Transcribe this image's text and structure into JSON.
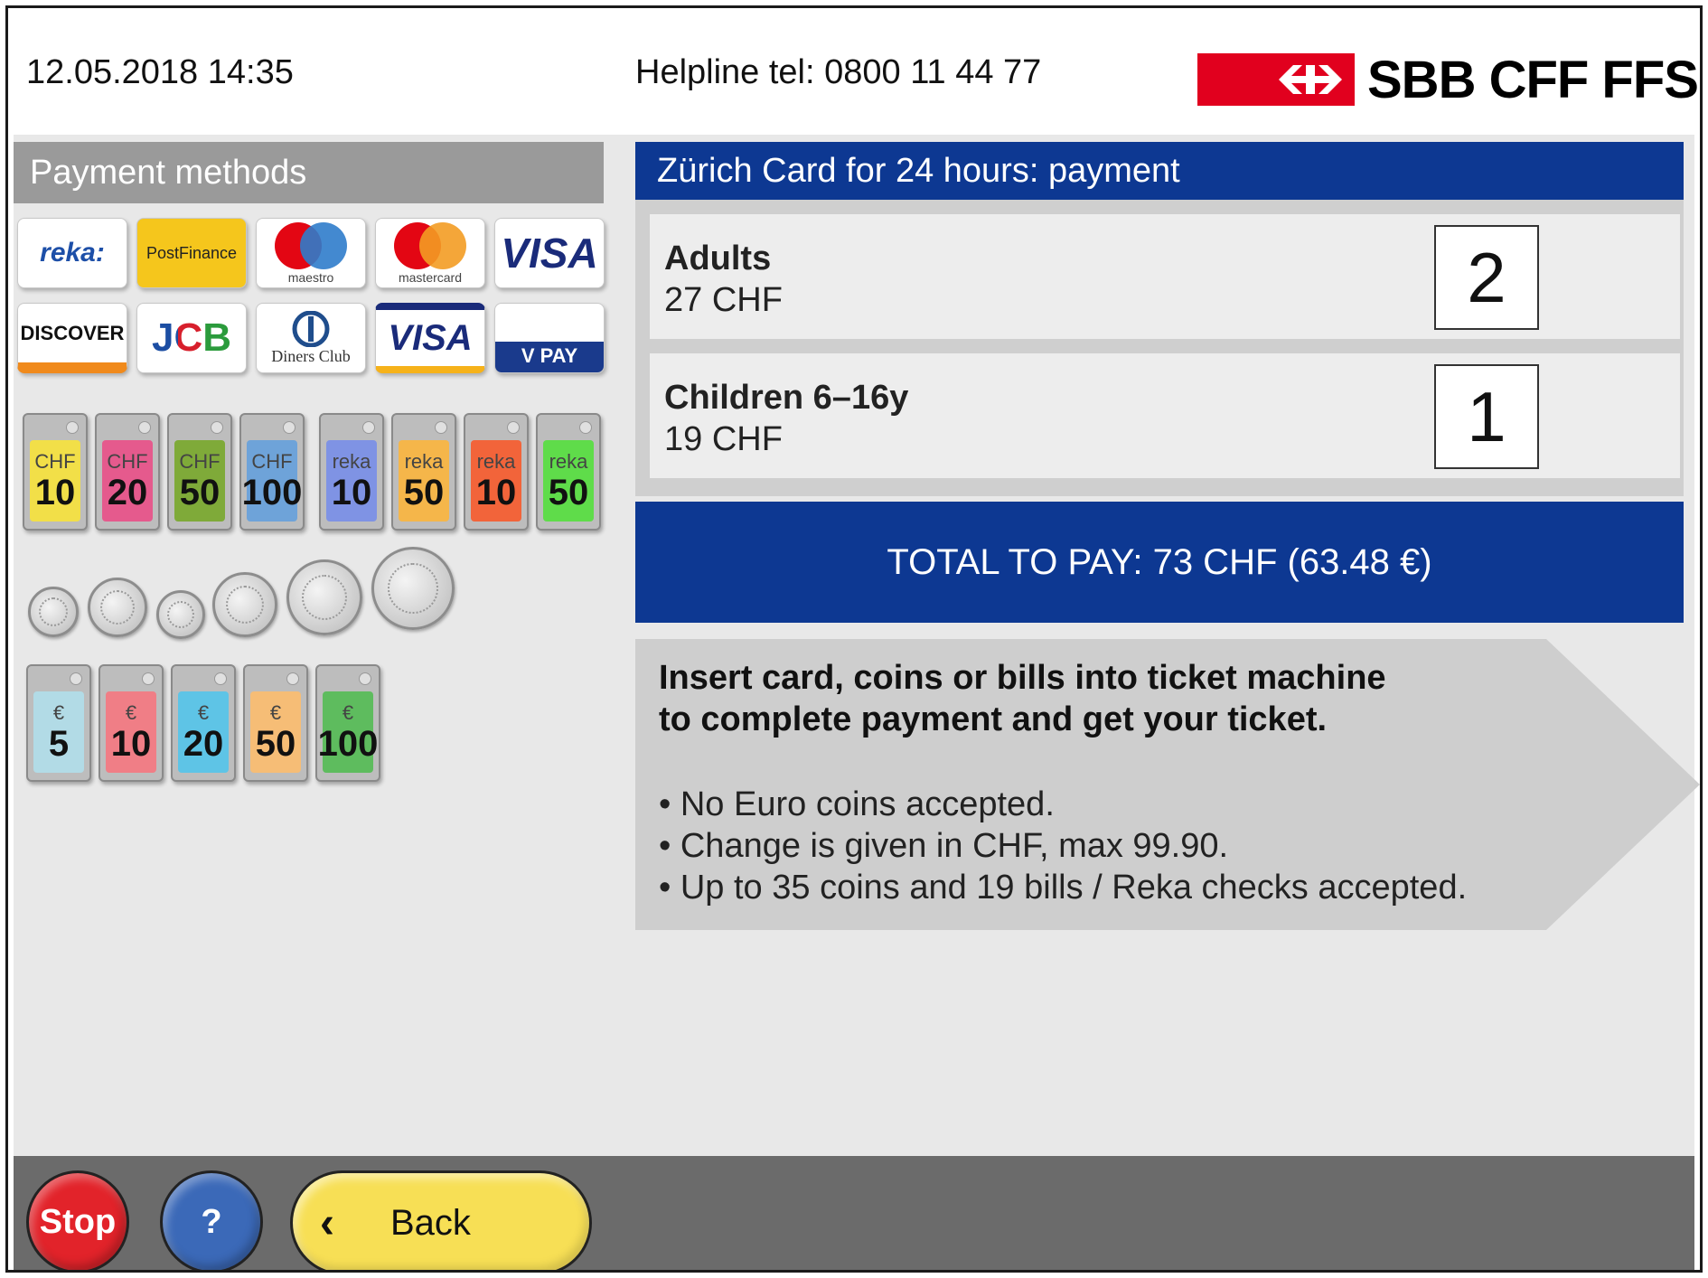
{
  "header": {
    "datetime": "12.05.2018 14:35",
    "helpline": "Helpline tel: 0800 11 44 77",
    "logo_text": "SBB CFF FFS"
  },
  "payment_methods": {
    "title": "Payment methods",
    "cards": [
      {
        "name": "reka",
        "label": "reka:"
      },
      {
        "name": "postfinance",
        "label": "PostFinance"
      },
      {
        "name": "maestro",
        "label": "maestro"
      },
      {
        "name": "mastercard",
        "label": "mastercard"
      },
      {
        "name": "visa",
        "label": "VISA"
      },
      {
        "name": "discover",
        "label": "DISCOVER"
      },
      {
        "name": "jcb",
        "label": "JCB"
      },
      {
        "name": "diners-club",
        "label": "Diners Club"
      },
      {
        "name": "visa-electron",
        "label": "VISA"
      },
      {
        "name": "v-pay",
        "label": "V PAY"
      }
    ],
    "chf_notes": [
      {
        "currency": "CHF",
        "value": "10",
        "color": "#f2df48"
      },
      {
        "currency": "CHF",
        "value": "20",
        "color": "#e55a8d"
      },
      {
        "currency": "CHF",
        "value": "50",
        "color": "#7faa39"
      },
      {
        "currency": "CHF",
        "value": "100",
        "color": "#6ea3d9"
      },
      {
        "currency": "reka",
        "value": "10",
        "color": "#7f93e4"
      },
      {
        "currency": "reka",
        "value": "50",
        "color": "#f5b64a"
      },
      {
        "currency": "reka",
        "value": "10",
        "color": "#f2643a"
      },
      {
        "currency": "reka",
        "value": "50",
        "color": "#5fdc4a"
      }
    ],
    "euro_notes": [
      {
        "currency": "€",
        "value": "5",
        "color": "#b2dbe6"
      },
      {
        "currency": "€",
        "value": "10",
        "color": "#f07e86"
      },
      {
        "currency": "€",
        "value": "20",
        "color": "#5ec4e6"
      },
      {
        "currency": "€",
        "value": "50",
        "color": "#f6bd76"
      },
      {
        "currency": "€",
        "value": "100",
        "color": "#5ebc5e"
      }
    ]
  },
  "payment": {
    "title": "Zürich Card for 24 hours: payment",
    "items": [
      {
        "label": "Adults",
        "price": "27 CHF",
        "quantity": "2"
      },
      {
        "label": "Children 6–16y",
        "price": "19 CHF",
        "quantity": "1"
      }
    ],
    "total": "TOTAL TO PAY: 73 CHF (63.48 €)",
    "instruction_line1": "Insert card, coins or bills into ticket machine",
    "instruction_line2": "to complete payment and get your ticket.",
    "notes": [
      "• No Euro coins accepted.",
      "• Change is given in CHF, max 99.90.",
      "• Up to 35 coins and 19 bills / Reka checks accepted."
    ]
  },
  "footer": {
    "stop_label": "Stop",
    "help_label": "?",
    "back_label": "Back",
    "back_arrow": "‹"
  }
}
